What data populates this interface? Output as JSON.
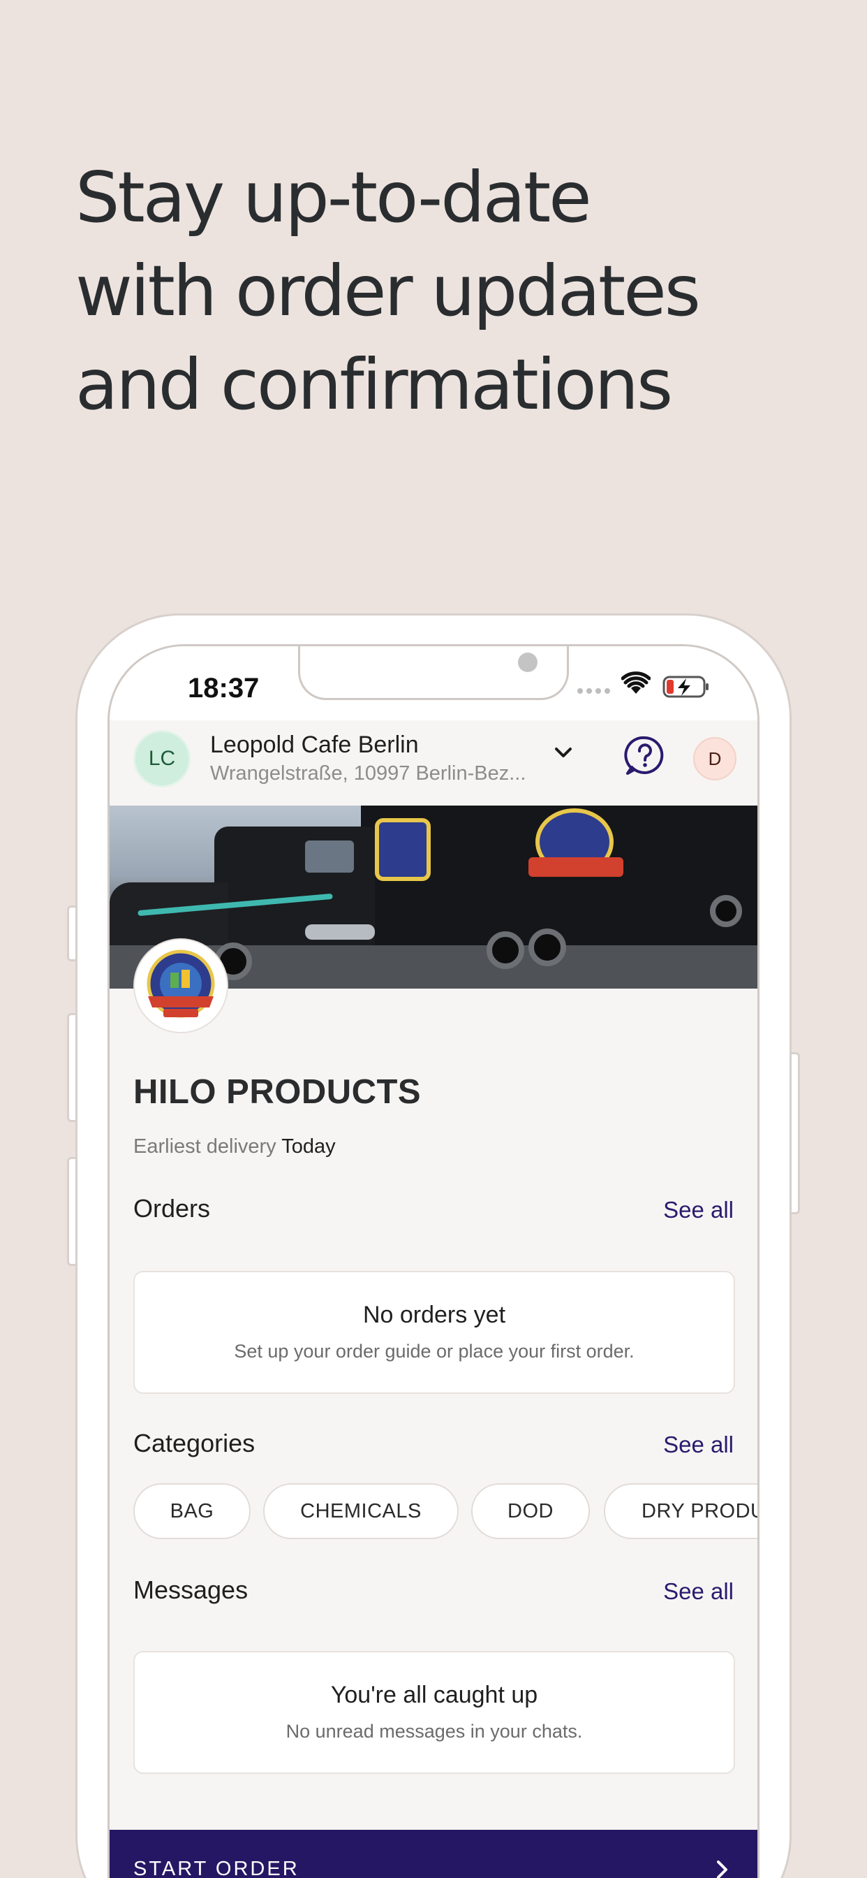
{
  "headline": {
    "line1": "Stay up-to-date",
    "line2": "with order updates",
    "line3": "and confirmations"
  },
  "status_bar": {
    "time": "18:37",
    "icons": [
      "cellular-signal-icon",
      "wifi-icon",
      "battery-charging-icon"
    ]
  },
  "header": {
    "venue_initials": "LC",
    "venue_name": "Leopold Cafe Berlin",
    "venue_address": "Wrangelstraße, 10997 Berlin-Bez...",
    "user_initial": "D",
    "icons": [
      "chevron-down-icon",
      "help-chat-icon"
    ]
  },
  "supplier": {
    "name": "HILO PRODUCTS",
    "delivery_label": "Earliest delivery",
    "delivery_value": "Today"
  },
  "orders": {
    "title": "Orders",
    "see_all": "See all",
    "empty_title": "No orders yet",
    "empty_sub": "Set up your order guide or place your first order."
  },
  "categories": {
    "title": "Categories",
    "see_all": "See all",
    "items": [
      "BAG",
      "CHEMICALS",
      "DOD",
      "DRY PRODU"
    ]
  },
  "messages": {
    "title": "Messages",
    "see_all": "See all",
    "empty_title": "You're all caught up",
    "empty_sub": "No unread messages in your chats."
  },
  "cta": {
    "label": "START ORDER",
    "icon": "chevron-right-icon"
  },
  "colors": {
    "page_bg": "#ede3de",
    "accent": "#261764",
    "link": "#2a1a6e",
    "venue_avatar": "#cfeedd",
    "user_avatar": "#fbe2da"
  }
}
